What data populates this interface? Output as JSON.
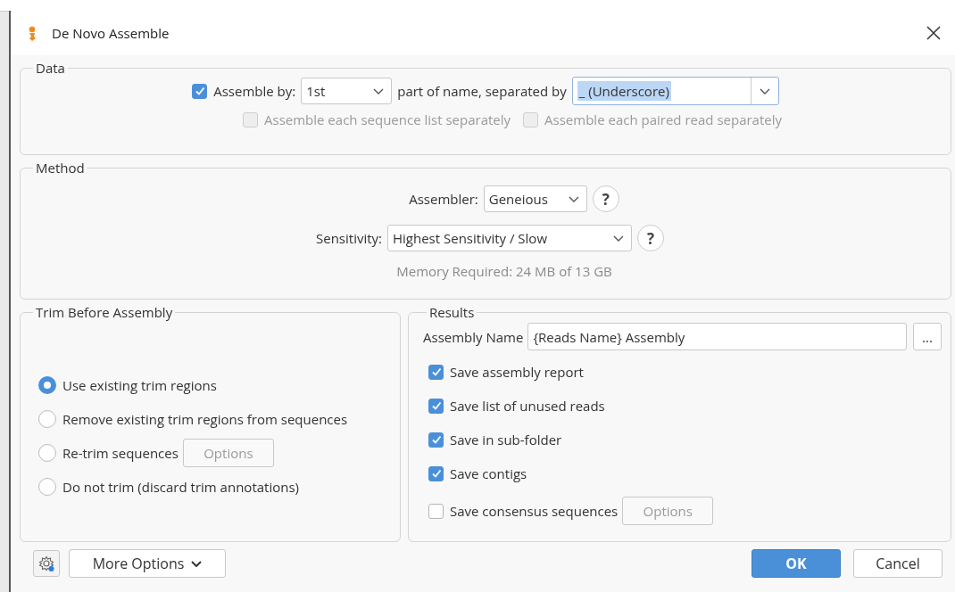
{
  "window": {
    "title": "De Novo Assemble"
  },
  "data": {
    "title": "Data",
    "assemble_by": {
      "label": "Assemble by:",
      "checked": true,
      "value": "1st"
    },
    "joiner": "part of name, separated by",
    "separator": {
      "value": "_ (Underscore)",
      "text_selected": true
    },
    "options": [
      {
        "label": "Assemble each sequence list separately",
        "checked": false,
        "disabled": true
      },
      {
        "label": "Assemble each paired read separately",
        "checked": false,
        "disabled": true
      }
    ]
  },
  "method": {
    "title": "Method",
    "rows": [
      {
        "label": "Assembler:",
        "value": "Geneious",
        "help": "?"
      },
      {
        "label": "Sensitivity:",
        "value": "Highest Sensitivity / Slow",
        "help": "?"
      }
    ],
    "memory": "Memory Required: 24 MB of 13 GB"
  },
  "trim": {
    "title": "Trim Before Assembly",
    "options": [
      {
        "label": "Use existing trim regions",
        "selected": true
      },
      {
        "label": "Remove existing trim regions from sequences",
        "selected": false
      },
      {
        "label": "Re-trim sequences",
        "selected": false,
        "button": {
          "label": "Options",
          "disabled": true
        }
      },
      {
        "label": "Do not trim (discard trim annotations)",
        "selected": false
      }
    ]
  },
  "results": {
    "title": "Results",
    "assembly_name": {
      "label": "Assembly Name",
      "value": "{Reads Name} Assembly",
      "button": "..."
    },
    "options": [
      {
        "label": "Save assembly report",
        "checked": true
      },
      {
        "label": "Save list of unused reads",
        "checked": true
      },
      {
        "label": "Save in sub-folder",
        "checked": true
      },
      {
        "label": "Save contigs",
        "checked": true
      },
      {
        "label": "Save consensus sequences",
        "checked": false,
        "button": {
          "label": "Options",
          "disabled": true
        }
      }
    ]
  },
  "footer": {
    "more_options": "More Options",
    "ok": "OK",
    "cancel": "Cancel"
  }
}
